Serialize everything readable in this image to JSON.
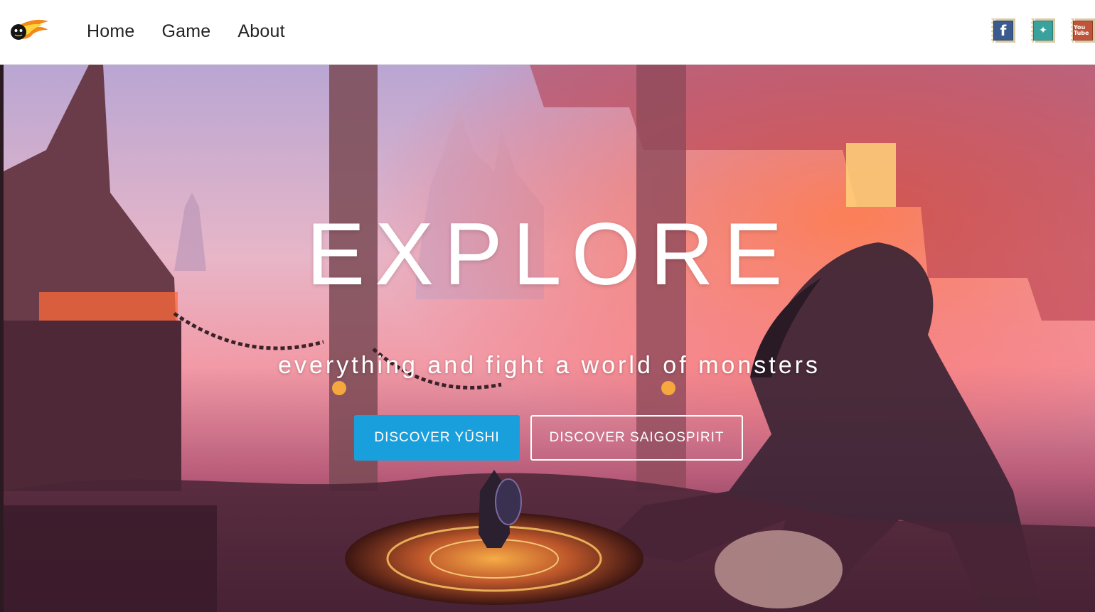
{
  "nav": {
    "logo_alt": "fireball logo",
    "links": [
      {
        "label": "Home"
      },
      {
        "label": "Game"
      },
      {
        "label": "About"
      }
    ],
    "social": [
      {
        "name": "facebook-icon",
        "glyph": "f"
      },
      {
        "name": "twitter-icon",
        "glyph": "✦"
      },
      {
        "name": "youtube-icon",
        "glyph": "You Tube"
      }
    ]
  },
  "hero": {
    "title": "EXPLORE",
    "subtitle": "everything and fight a world of monsters",
    "primary_button": "DISCOVER YŪSHI",
    "secondary_button": "DISCOVER SAIGOSPIRIT"
  },
  "colors": {
    "accent": "#1a9fdd",
    "nav_text": "#222222",
    "hero_text": "#ffffff"
  }
}
